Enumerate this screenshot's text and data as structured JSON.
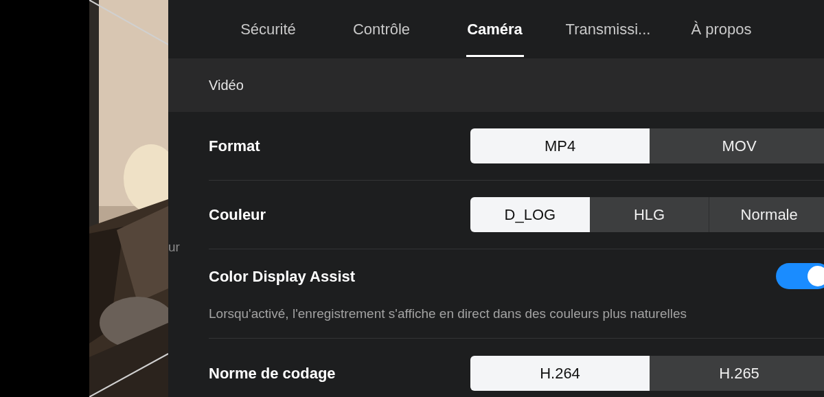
{
  "tabs": [
    {
      "label": "Sécurité",
      "selected": false
    },
    {
      "label": "Contrôle",
      "selected": false
    },
    {
      "label": "Caméra",
      "selected": true
    },
    {
      "label": "Transmissi...",
      "selected": false
    },
    {
      "label": "À propos",
      "selected": false
    }
  ],
  "behind_text": "ur",
  "section": {
    "title": "Vidéo"
  },
  "rows": [
    {
      "kind": "segmented",
      "label": "Format",
      "options": [
        {
          "label": "MP4",
          "selected": true
        },
        {
          "label": "MOV",
          "selected": false
        }
      ]
    },
    {
      "kind": "segmented",
      "label": "Couleur",
      "options": [
        {
          "label": "D_LOG",
          "selected": true
        },
        {
          "label": "HLG",
          "selected": false
        },
        {
          "label": "Normale",
          "selected": false
        }
      ]
    },
    {
      "kind": "toggle",
      "label": "Color Display Assist",
      "on": true,
      "description": "Lorsqu'activé, l'enregistrement s'affiche en direct dans des couleurs plus naturelles"
    },
    {
      "kind": "segmented",
      "label": "Norme de codage",
      "options": [
        {
          "label": "H.264",
          "selected": true
        },
        {
          "label": "H.265",
          "selected": false
        }
      ]
    }
  ]
}
